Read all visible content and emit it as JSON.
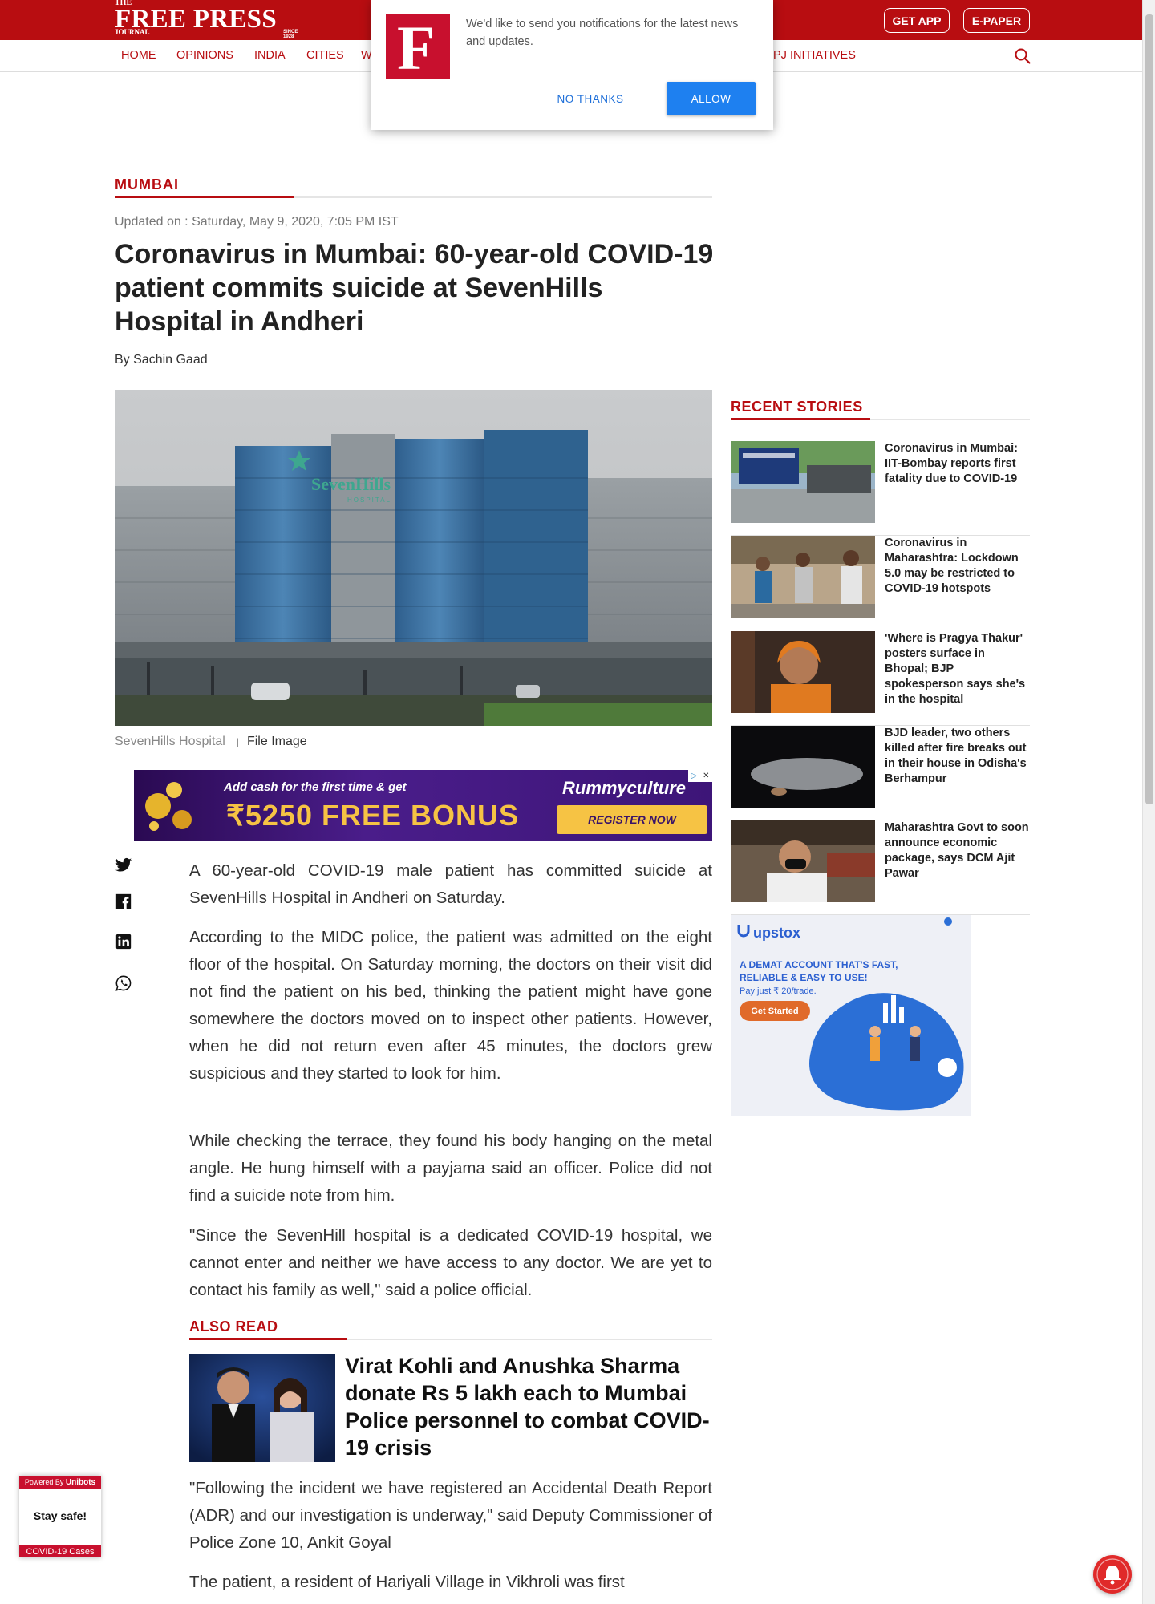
{
  "header": {
    "logo": {
      "the": "THE",
      "name": "FREE PRESS",
      "journal": "JOURNAL",
      "since": "SINCE 1928"
    },
    "get_app": "GET APP",
    "epaper": "E-PAPER"
  },
  "nav": {
    "items": [
      "HOME",
      "OPINIONS",
      "INDIA",
      "CITIES",
      "W",
      "PJ INITIATIVES"
    ],
    "search_icon": "search-icon"
  },
  "popup": {
    "logo_letter": "F",
    "message": "We'd like to send you notifications for the latest news and updates.",
    "no_thanks": "NO THANKS",
    "allow": "ALLOW"
  },
  "article": {
    "category": "MUMBAI",
    "updated": "Updated on : Saturday, May 9, 2020, 7:05 PM IST",
    "title": "Coronavirus in Mumbai: 60-year-old COVID-19 patient commits suicide at SevenHills Hospital in Andheri",
    "byline": "By Sachin Gaad",
    "image_sign": "SevenHills",
    "image_sign_sub": "HOSPITAL",
    "caption": "SevenHills Hospital",
    "caption_credit": "File Image",
    "paragraphs": [
      "A 60-year-old COVID-19 male patient has committed suicide at SevenHills Hospital in Andheri on Saturday.",
      "According to the MIDC police, the patient was admitted on the eight floor of the hospital. On Saturday morning, the doctors on their visit did not find the patient on his bed, thinking the patient might have gone somewhere the doctors moved on to inspect other patients. However, when he did not return even after 45 minutes, the doctors grew suspicious and they started to look for him.",
      "While checking the terrace, they found his body hanging on the metal angle. He hung himself with a payjama said an officer. Police did not find a suicide note from him.",
      "\"Since the SevenHill hospital is a dedicated COVID-19 hospital, we cannot enter and neither we have access to any doctor. We are yet to contact his family as well,\" said a police official.",
      "\"Following the incident we have registered an Accidental Death Report (ADR) and our investigation is underway,\" said Deputy Commissioner of Police Zone 10, Ankit Goyal",
      "The patient, a resident of Hariyali Village in Vikhroli was first"
    ],
    "also_read_label": "ALSO READ",
    "also_read_title": "Virat Kohli and Anushka Sharma donate Rs 5 lakh each to Mumbai Police personnel to combat COVID-19 crisis"
  },
  "ad_banner": {
    "line1": "Add cash for the first time & get",
    "brand": "Rummyculture",
    "offer": "₹5250 FREE BONUS",
    "cta": "REGISTER NOW"
  },
  "share": [
    "twitter-icon",
    "facebook-icon",
    "linkedin-icon",
    "whatsapp-icon"
  ],
  "sidebar": {
    "heading": "RECENT STORIES",
    "stories": [
      "Coronavirus in Mumbai: IIT-Bombay reports first fatality due to COVID-19",
      "Coronavirus in Maharashtra: Lockdown 5.0 may be restricted to COVID-19 hotspots",
      "'Where is Pragya Thakur' posters surface in Bhopal; BJP spokesperson says she's in the hospital",
      "BJD leader, two others killed after fire breaks out in their house in Odisha's Berhampur",
      "Maharashtra Govt to soon announce economic package, says DCM Ajit Pawar"
    ],
    "ad": {
      "brand": "upstox",
      "headline": "A DEMAT ACCOUNT THAT'S FAST, RELIABLE & EASY TO USE!",
      "sub": "Pay just ₹ 20/trade.",
      "cta": "Get Started"
    }
  },
  "widget": {
    "powered": "Powered By",
    "brand": "Unibots",
    "message": "Stay safe!",
    "footer": "COVID-19 Cases"
  },
  "colors": {
    "brand_red": "#b80d11",
    "allow_blue": "#1e80f0"
  }
}
